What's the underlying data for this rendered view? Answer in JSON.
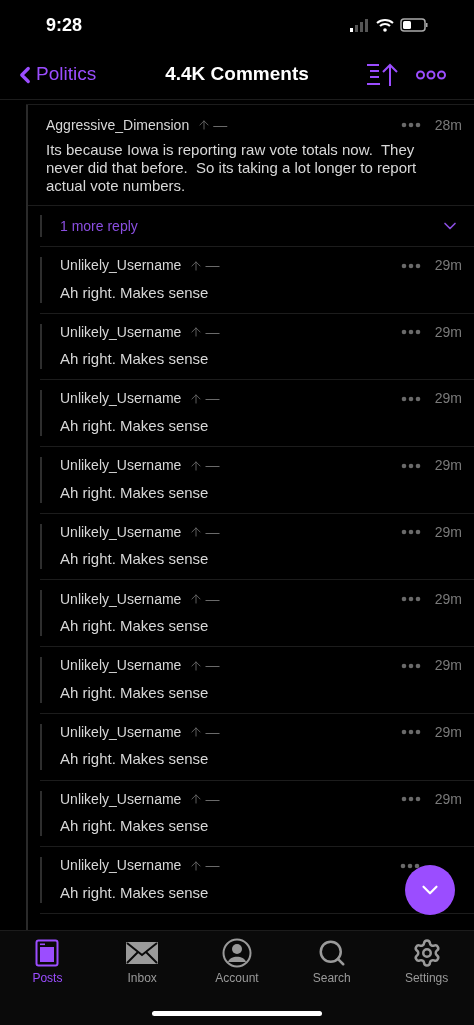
{
  "status_bar": {
    "time": "9:28"
  },
  "nav": {
    "back_label": "Politics",
    "title": "4.4K Comments"
  },
  "parent_comment": {
    "author": "Aggressive_Dimension",
    "score": "—",
    "time": "28m",
    "body": "Its because Iowa is reporting raw vote totals now.  They never did that before.  So its taking a lot longer to report actual vote numbers."
  },
  "more_replies": {
    "label": "1 more reply",
    "expanded": false
  },
  "replies": [
    {
      "author": "Unlikely_Username",
      "score": "—",
      "time": "29m",
      "body": "Ah right. Makes sense"
    },
    {
      "author": "Unlikely_Username",
      "score": "—",
      "time": "29m",
      "body": "Ah right. Makes sense"
    },
    {
      "author": "Unlikely_Username",
      "score": "—",
      "time": "29m",
      "body": "Ah right. Makes sense"
    },
    {
      "author": "Unlikely_Username",
      "score": "—",
      "time": "29m",
      "body": "Ah right. Makes sense"
    },
    {
      "author": "Unlikely_Username",
      "score": "—",
      "time": "29m",
      "body": "Ah right. Makes sense"
    },
    {
      "author": "Unlikely_Username",
      "score": "—",
      "time": "29m",
      "body": "Ah right. Makes sense"
    },
    {
      "author": "Unlikely_Username",
      "score": "—",
      "time": "29m",
      "body": "Ah right. Makes sense"
    },
    {
      "author": "Unlikely_Username",
      "score": "—",
      "time": "29m",
      "body": "Ah right. Makes sense"
    },
    {
      "author": "Unlikely_Username",
      "score": "—",
      "time": "29m",
      "body": "Ah right. Makes sense"
    },
    {
      "author": "Unlikely_Username",
      "score": "—",
      "body": "Ah right. Makes sense"
    }
  ],
  "tab_bar": [
    {
      "kind": "posts",
      "label": "Posts",
      "selected": true
    },
    {
      "kind": "inbox",
      "label": "Inbox",
      "selected": false
    },
    {
      "kind": "account",
      "label": "Account",
      "selected": false
    },
    {
      "kind": "search",
      "label": "Search",
      "selected": false
    },
    {
      "kind": "settings",
      "label": "Settings",
      "selected": false
    }
  ]
}
